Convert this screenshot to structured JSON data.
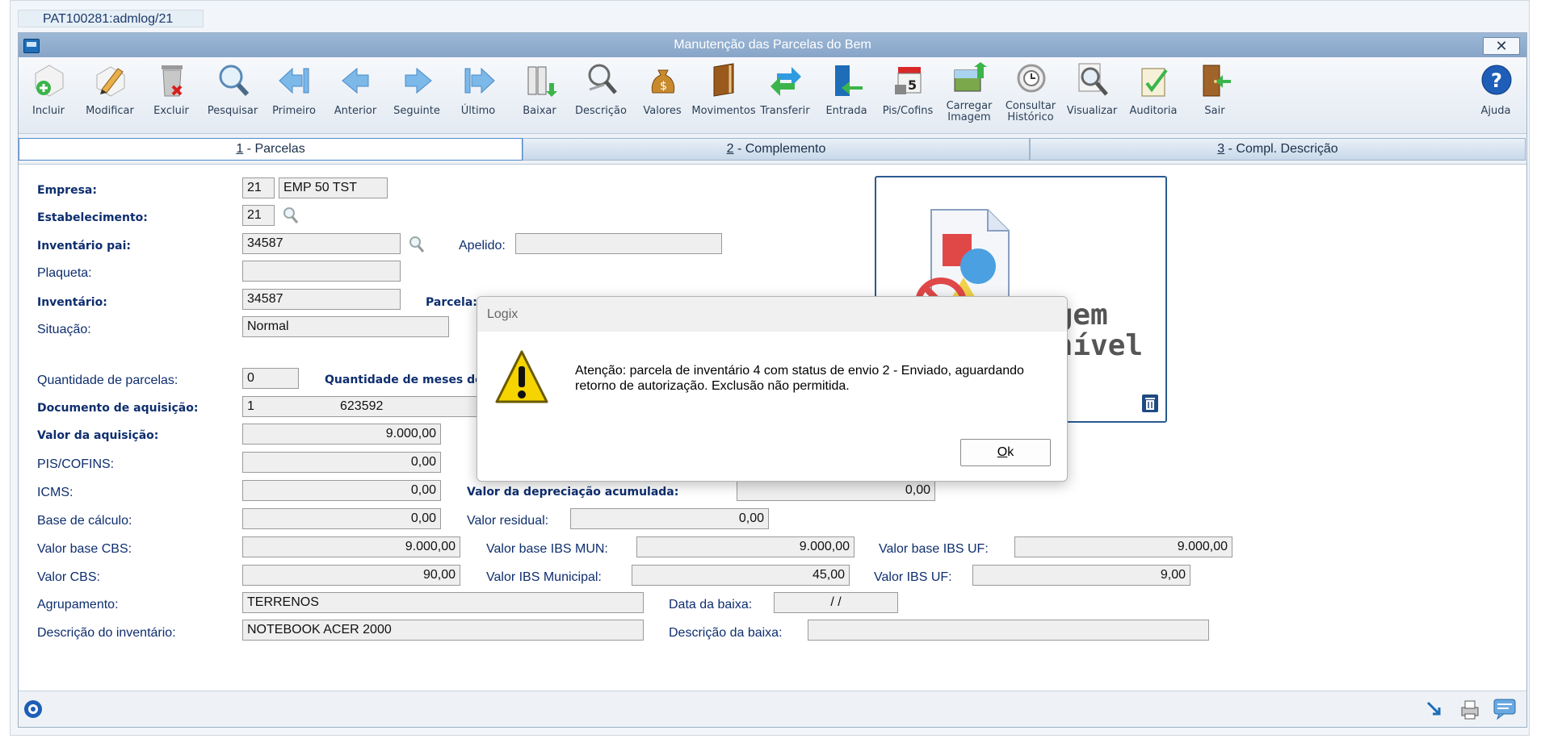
{
  "session_tab": "PAT100281:admlog/21",
  "window": {
    "title": "Manutenção das Parcelas do Bem"
  },
  "toolbar": [
    {
      "label": "Incluir",
      "icon": "add-icon"
    },
    {
      "label": "Modificar",
      "icon": "edit-icon"
    },
    {
      "label": "Excluir",
      "icon": "trash-icon"
    },
    {
      "label": "Pesquisar",
      "icon": "search-icon"
    },
    {
      "label": "Primeiro",
      "icon": "first-arrow-icon"
    },
    {
      "label": "Anterior",
      "icon": "previous-arrow-icon"
    },
    {
      "label": "Seguinte",
      "icon": "next-arrow-icon"
    },
    {
      "label": "Último",
      "icon": "last-arrow-icon"
    },
    {
      "label": "Baixar",
      "icon": "write-off-icon"
    },
    {
      "label": "Descrição",
      "icon": "description-icon"
    },
    {
      "label": "Valores",
      "icon": "money-bag-icon"
    },
    {
      "label": "Movimentos",
      "icon": "book-icon"
    },
    {
      "label": "Transferir",
      "icon": "transfer-icon"
    },
    {
      "label": "Entrada",
      "icon": "entry-icon"
    },
    {
      "label": "Pis/Cofins",
      "icon": "calendar-icon"
    },
    {
      "label": "Carregar Imagem",
      "icon": "load-image-icon"
    },
    {
      "label": "Consultar Histórico",
      "icon": "history-icon"
    },
    {
      "label": "Visualizar",
      "icon": "view-icon"
    },
    {
      "label": "Auditoria",
      "icon": "audit-icon"
    },
    {
      "label": "Sair",
      "icon": "exit-icon"
    },
    {
      "label": "Ajuda",
      "icon": "help-icon"
    }
  ],
  "tabs": [
    {
      "num": "1",
      "label": " - Parcelas"
    },
    {
      "num": "2",
      "label": " - Complemento"
    },
    {
      "num": "3",
      "label": " - Compl. Descrição"
    }
  ],
  "form": {
    "empresa": {
      "label": "Empresa:",
      "code": "21",
      "name": "EMP 50 TST"
    },
    "estabelecimento": {
      "label": "Estabelecimento:",
      "code": "21"
    },
    "inventario_pai": {
      "label": "Inventário pai:",
      "value": "34587"
    },
    "apelido": {
      "label": "Apelido:",
      "value": ""
    },
    "plaqueta": {
      "label": "Plaqueta:",
      "value": ""
    },
    "inventario": {
      "label": "Inventário:",
      "value": "34587"
    },
    "parcela": {
      "label": "Parcela:"
    },
    "situacao": {
      "label": "Situação:",
      "value": "Normal"
    },
    "qtd_parcelas": {
      "label": "Quantidade de parcelas:",
      "value": "0"
    },
    "qtd_meses": {
      "label": "Quantidade de meses dep"
    },
    "documento": {
      "label": "Documento de aquisição:",
      "value1": "1",
      "value2": "623592"
    },
    "valor_aquisicao": {
      "label": "Valor da aquisição:",
      "value": "9.000,00"
    },
    "pis_cofins": {
      "label": "PIS/COFINS:",
      "value": "0,00"
    },
    "icms": {
      "label": "ICMS:",
      "value": "0,00"
    },
    "valor_depreciacao": {
      "label": "Valor da depreciação acumulada:",
      "value": "0,00"
    },
    "base_calculo": {
      "label": "Base de cálculo:",
      "value": "0,00"
    },
    "valor_residual": {
      "label": "Valor residual:",
      "value": "0,00"
    },
    "valor_base_cbs": {
      "label": "Valor base CBS:",
      "value": "9.000,00"
    },
    "valor_base_ibs_mun": {
      "label": "Valor base IBS MUN:",
      "value": "9.000,00"
    },
    "valor_base_ibs_uf": {
      "label": "Valor base IBS UF:",
      "value": "9.000,00"
    },
    "valor_cbs": {
      "label": "Valor CBS:",
      "value": "90,00"
    },
    "valor_ibs_municipal": {
      "label": "Valor IBS Municipal:",
      "value": "45,00"
    },
    "valor_ibs_uf": {
      "label": "Valor IBS UF:",
      "value": "9,00"
    },
    "agrupamento": {
      "label": "Agrupamento:",
      "value": "TERRENOS"
    },
    "data_baixa": {
      "label": "Data da baixa:",
      "value": " /  /"
    },
    "descricao_inventario": {
      "label": "Descrição do inventário:",
      "value": "NOTEBOOK ACER 2000"
    },
    "descricao_baixa": {
      "label": "Descrição da baixa:",
      "value": ""
    }
  },
  "image_panel": {
    "text_line1": "agem",
    "text_line2": "onível"
  },
  "dialog": {
    "title": "Logix",
    "message": "Atenção: parcela de inventário    4 com status de envio 2 - Enviado, aguardando retorno de autorização. Exclusão não permitida.",
    "ok_prefix": "O",
    "ok_rest": "k"
  },
  "colors": {
    "title_bar": "#8fadce",
    "label": "#0e2e6e",
    "field_bg": "#efefef",
    "accent": "#1e6db8"
  }
}
